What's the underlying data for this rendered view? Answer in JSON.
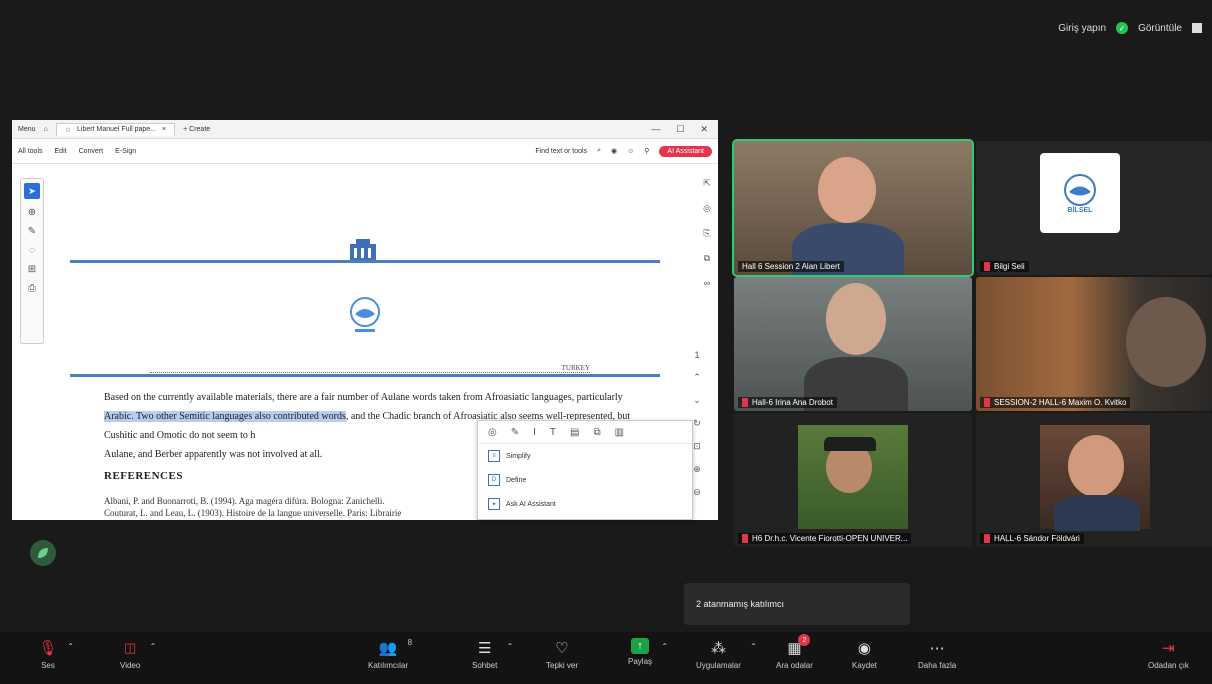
{
  "top_right": {
    "signin_label": "Giriş yapın",
    "view_label": "Görüntüle"
  },
  "acrobat": {
    "tabs": [
      "Menu",
      "Libert Manuel Full pape...",
      "+ Create"
    ],
    "menu": [
      "All tools",
      "Edit",
      "Convert",
      "E-Sign"
    ],
    "find_placeholder": "Find text or tools",
    "ai_button": "AI Assistant",
    "doc": {
      "header_right": "TURKEY",
      "paragraph_before": "Based on the currently available materials, there are a fair number of Aulane words taken from Afroasiatic languages, particularly",
      "highlighted": "Arabic. Two other Semitic languages also contributed words",
      "paragraph_after": ", and the Chadic branch of Afroasiatic also seems well-represented, but Cushitic and Omotic do not seem to h",
      "paragraph_end": "Aulane, and Berber apparently was not involved at all.",
      "references_heading": "REFERENCES",
      "ref1": "Albani, P. and Buonarroti, B. (1994). Aga magéra difúra. Bologna: Zanichelli.",
      "ref2": "Couturat, L. and Leau, L. (1903). Histoire de la langue universelle. Paris: Librairie"
    },
    "popup_items": [
      "Simplify",
      "Define",
      "Ask AI Assistant"
    ]
  },
  "participants": [
    {
      "name": "Hall 6 Session 2 Alan Libert",
      "muted": false,
      "active": true
    },
    {
      "name": "Bilgi Seli",
      "muted": true,
      "active": false
    },
    {
      "name": "Hall-6 Irina Ana Drobot",
      "muted": true,
      "active": false
    },
    {
      "name": "SESSION-2 HALL-6 Maxim O. Kvitko",
      "muted": true,
      "active": false
    },
    {
      "name": "H6 Dr.h.c. Vicente Fiorotti-OPEN UNIVER...",
      "muted": true,
      "active": false
    },
    {
      "name": "HALL-6 Sándor Földvári",
      "muted": true,
      "active": false
    }
  ],
  "bilgi_logo_text": "BİLSEL",
  "notification": "2 atanmamış katılımcı",
  "toolbar": {
    "audio": "Ses",
    "video": "Video",
    "participants": "Katılımcılar",
    "participants_count": "8",
    "chat": "Sohbet",
    "react": "Tepki ver",
    "share": "Paylaş",
    "apps": "Uygulamalar",
    "breakout": "Ara odalar",
    "breakout_badge": "2",
    "record": "Kaydet",
    "more": "Daha fazla",
    "leave": "Odadan çık"
  },
  "colors": {
    "accent_green": "#2ecc71",
    "share_green": "#1fa247",
    "mute_red": "#e0354d",
    "doc_blue": "#4a7fc2"
  }
}
